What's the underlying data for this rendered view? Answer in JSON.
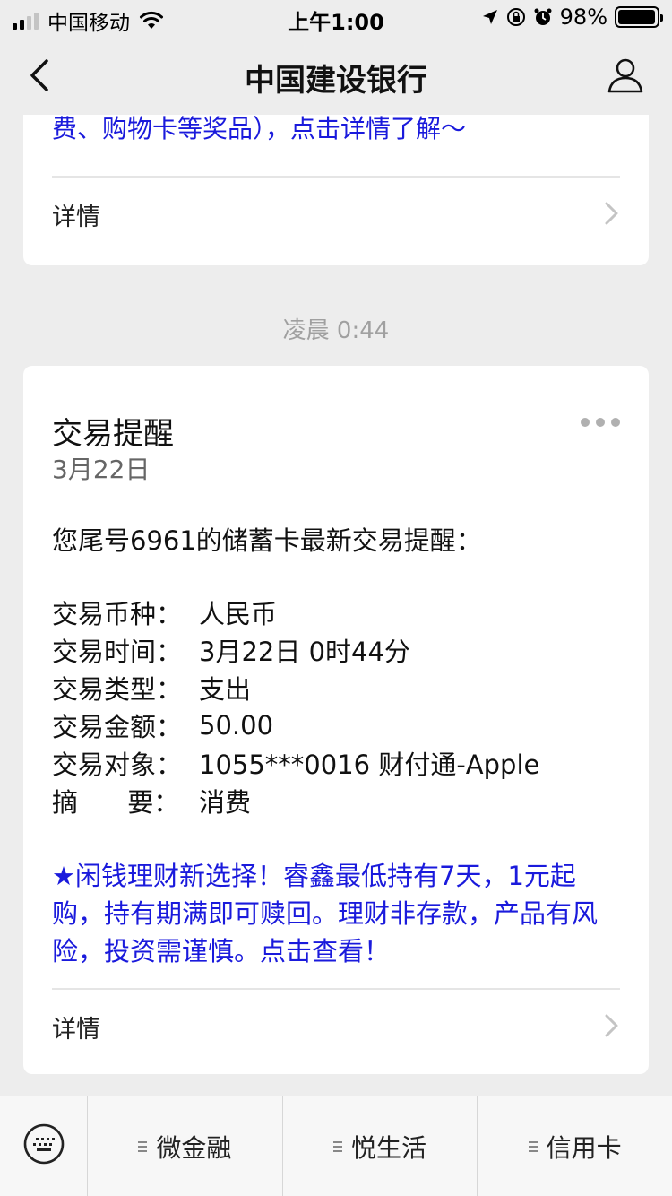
{
  "status_bar": {
    "carrier": "中国移动",
    "time": "上午1:00",
    "battery_percent": "98%",
    "battery_level": 0.98,
    "icons": [
      "signal-icon",
      "wifi-icon",
      "location-icon",
      "orientation-lock-icon",
      "alarm-icon",
      "battery-icon"
    ]
  },
  "nav": {
    "title": "中国建设银行",
    "back_icon": "chevron-left-icon",
    "profile_icon": "user-icon"
  },
  "messages": [
    {
      "text": "费、购物卡等奖品），点击详情了解～",
      "detail_label": "详情"
    }
  ],
  "timestamp": "凌晨 0:44",
  "transaction_card": {
    "title": "交易提醒",
    "date": "3月22日",
    "intro": "您尾号6961的储蓄卡最新交易提醒：",
    "fields": [
      {
        "label": "交易币种：",
        "value": "人民币"
      },
      {
        "label": "交易时间：",
        "value": "3月22日 0时44分"
      },
      {
        "label": "交易类型：",
        "value": "支出"
      },
      {
        "label": "交易金额：",
        "value": "50.00"
      },
      {
        "label": "交易对象：",
        "value": "1055***0016 财付通-Apple"
      },
      {
        "label": "摘      要：",
        "value": "消费"
      }
    ],
    "promo": "★闲钱理财新选择！睿鑫最低持有7天，1元起购，持有期满即可赎回。理财非存款，产品有风险，投资需谨慎。点击查看！",
    "detail_label": "详情"
  },
  "menu": {
    "keyboard_icon": "keyboard-icon",
    "items": [
      {
        "label": "微金融"
      },
      {
        "label": "悦生活"
      },
      {
        "label": "信用卡"
      }
    ]
  },
  "colors": {
    "link_blue": "#1a1adc",
    "background": "#ededed",
    "card": "#ffffff",
    "muted_text": "#a0a0a0"
  }
}
